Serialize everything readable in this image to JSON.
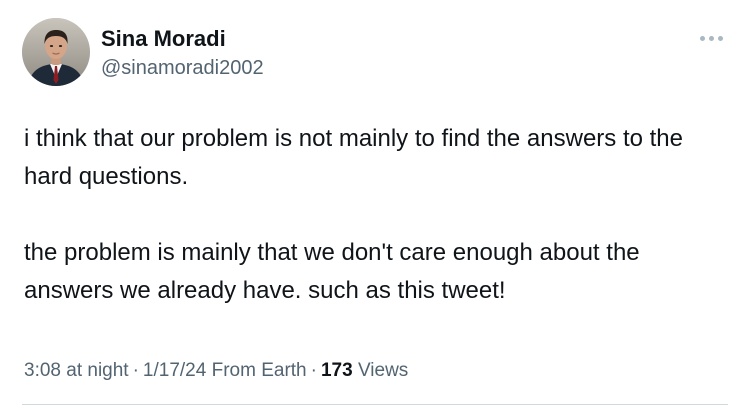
{
  "author": {
    "display_name": "Sina Moradi",
    "handle": "@sinamoradi2002",
    "avatar_icon": "profile-photo"
  },
  "more_icon": "ellipsis-icon",
  "tweet": {
    "paragraphs": [
      "i think that our problem is not mainly to find the answers to the hard questions.",
      "the problem is mainly that we don't care enough about the answers we already have. such as this tweet!"
    ]
  },
  "meta": {
    "time": "3:08 at night",
    "date": "1/17/24",
    "location": "From Earth",
    "views_count": "173",
    "views_label": "Views",
    "separator": "·"
  },
  "colors": {
    "text_primary": "#0f1419",
    "text_secondary": "#536471",
    "divider": "#cfd9de",
    "more_dots": "#aab8c2"
  }
}
